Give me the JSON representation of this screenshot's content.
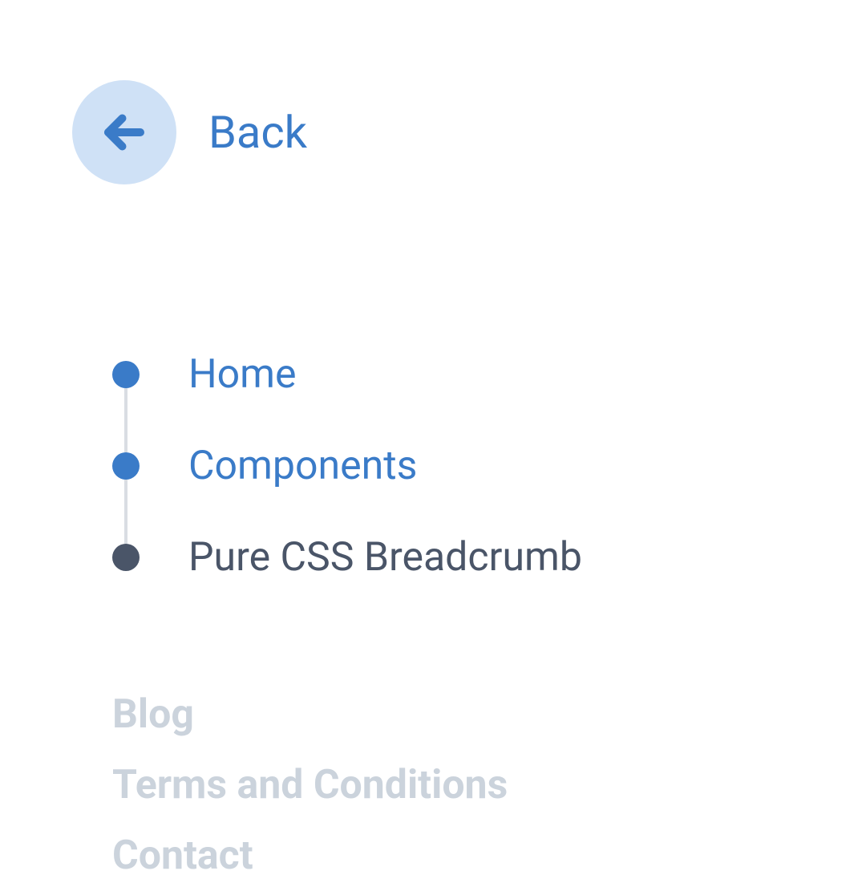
{
  "back": {
    "label": "Back"
  },
  "breadcrumb": {
    "items": [
      {
        "label": "Home",
        "current": false
      },
      {
        "label": "Components",
        "current": false
      },
      {
        "label": "Pure CSS Breadcrumb",
        "current": true
      }
    ]
  },
  "links": {
    "items": [
      {
        "label": "Blog"
      },
      {
        "label": "Terms and Conditions"
      },
      {
        "label": "Contact"
      }
    ]
  },
  "colors": {
    "accent": "#3a7bc8",
    "accent_light": "#cfe1f6",
    "text_dark": "#4a5568",
    "text_muted": "#cbd3dc"
  }
}
